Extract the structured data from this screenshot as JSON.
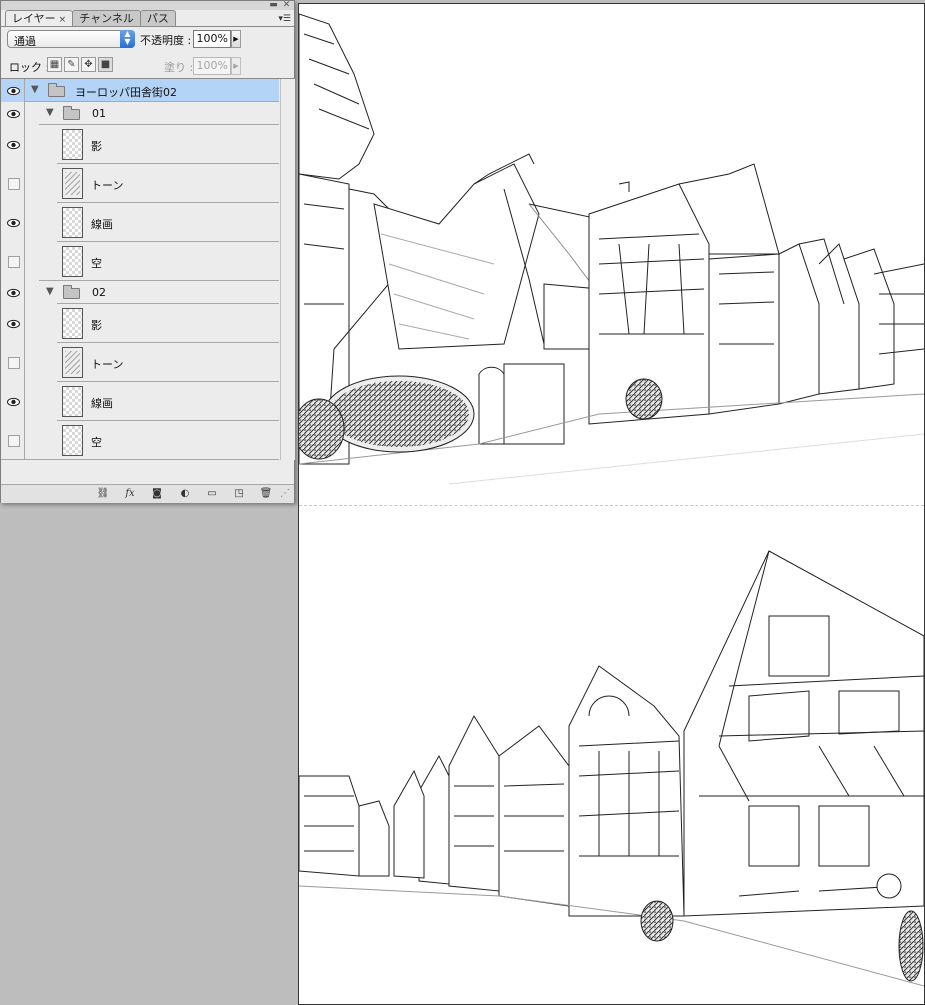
{
  "panel": {
    "tabs": [
      {
        "label": "レイヤー",
        "close": "×"
      },
      {
        "label": "チャンネル"
      },
      {
        "label": "パス"
      }
    ],
    "blend_mode": "通過",
    "opacity_label": "不透明度 :",
    "opacity_value": "100%",
    "lock_label": "ロック :",
    "fill_label": "塗り :",
    "fill_value": "100%",
    "menu_icon": "▾☰"
  },
  "layers": [
    {
      "name": "ヨーロッパ田舎街02",
      "type": "group",
      "visible": true,
      "selected": true
    },
    {
      "name": "01",
      "type": "group",
      "visible": true
    },
    {
      "name": "影",
      "type": "layer",
      "visible": true
    },
    {
      "name": "トーン",
      "type": "layer",
      "visible": false
    },
    {
      "name": "線画",
      "type": "layer",
      "visible": true
    },
    {
      "name": "空",
      "type": "layer",
      "visible": false
    },
    {
      "name": "02",
      "type": "group",
      "visible": true
    },
    {
      "name": "影",
      "type": "layer",
      "visible": true
    },
    {
      "name": "トーン",
      "type": "layer",
      "visible": false
    },
    {
      "name": "線画",
      "type": "layer",
      "visible": true
    },
    {
      "name": "空",
      "type": "layer",
      "visible": false
    }
  ],
  "bottom_icons": [
    "link-icon",
    "fx-icon",
    "mask-icon",
    "adjustment-icon",
    "new-group-icon",
    "new-layer-icon",
    "trash-icon"
  ],
  "fx_text": "fx"
}
